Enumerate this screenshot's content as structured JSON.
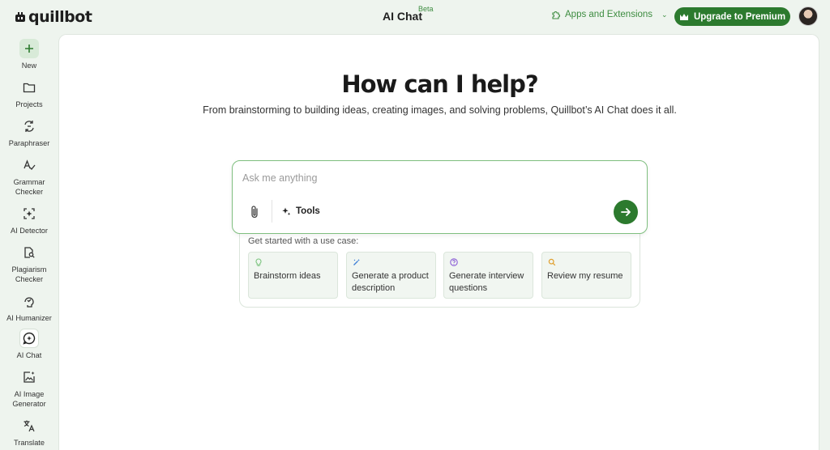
{
  "header": {
    "logo_text": "quillbot",
    "title": "AI Chat",
    "badge": "Beta",
    "apps_label": "Apps and Extensions",
    "premium_label": "Upgrade to Premium"
  },
  "sidebar": {
    "items": [
      {
        "label": "New",
        "icon": "plus-icon"
      },
      {
        "label": "Projects",
        "icon": "folder-icon"
      },
      {
        "label": "Paraphraser",
        "icon": "paraphraser-icon"
      },
      {
        "label": "Grammar Checker",
        "icon": "grammar-check-icon"
      },
      {
        "label": "AI Detector",
        "icon": "ai-detector-icon"
      },
      {
        "label": "Plagiarism Checker",
        "icon": "plagiarism-icon"
      },
      {
        "label": "AI Humanizer",
        "icon": "humanizer-icon"
      },
      {
        "label": "AI Chat",
        "icon": "chat-icon"
      },
      {
        "label": "AI Image Generator",
        "icon": "image-generator-icon"
      },
      {
        "label": "Translate",
        "icon": "translate-icon"
      }
    ]
  },
  "main": {
    "headline": "How can I help?",
    "subline": "From brainstorming to building ideas, creating images, and solving problems, Quillbot’s AI Chat does it all.",
    "input_placeholder": "Ask me anything",
    "tools_label": "Tools",
    "usecase_title": "Get started with a use case:",
    "usecases": [
      {
        "label": "Brainstorm ideas",
        "icon": "lightbulb-icon",
        "color": "#7cc47f"
      },
      {
        "label": "Generate a product description",
        "icon": "magic-wand-icon",
        "color": "#3d7fd6"
      },
      {
        "label": "Generate interview questions",
        "icon": "question-icon",
        "color": "#8a5cd6"
      },
      {
        "label": "Review my resume",
        "icon": "magnifier-icon",
        "color": "#e0a030"
      }
    ]
  },
  "colors": {
    "brand_green": "#2c7a2e",
    "accent_green": "#3d8c40",
    "background": "#eef4ee"
  }
}
